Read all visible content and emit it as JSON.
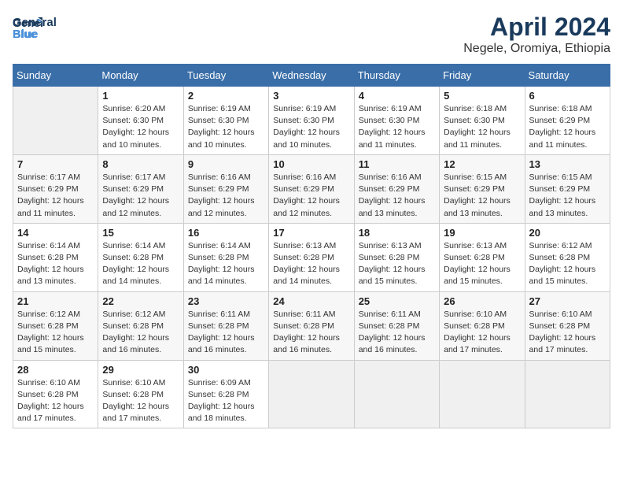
{
  "logo": {
    "line1": "General",
    "line2": "Blue"
  },
  "title": "April 2024",
  "location": "Negele, Oromiya, Ethiopia",
  "days_header": [
    "Sunday",
    "Monday",
    "Tuesday",
    "Wednesday",
    "Thursday",
    "Friday",
    "Saturday"
  ],
  "weeks": [
    [
      {
        "day": "",
        "info": ""
      },
      {
        "day": "1",
        "info": "Sunrise: 6:20 AM\nSunset: 6:30 PM\nDaylight: 12 hours\nand 10 minutes."
      },
      {
        "day": "2",
        "info": "Sunrise: 6:19 AM\nSunset: 6:30 PM\nDaylight: 12 hours\nand 10 minutes."
      },
      {
        "day": "3",
        "info": "Sunrise: 6:19 AM\nSunset: 6:30 PM\nDaylight: 12 hours\nand 10 minutes."
      },
      {
        "day": "4",
        "info": "Sunrise: 6:19 AM\nSunset: 6:30 PM\nDaylight: 12 hours\nand 11 minutes."
      },
      {
        "day": "5",
        "info": "Sunrise: 6:18 AM\nSunset: 6:30 PM\nDaylight: 12 hours\nand 11 minutes."
      },
      {
        "day": "6",
        "info": "Sunrise: 6:18 AM\nSunset: 6:29 PM\nDaylight: 12 hours\nand 11 minutes."
      }
    ],
    [
      {
        "day": "7",
        "info": "Sunrise: 6:17 AM\nSunset: 6:29 PM\nDaylight: 12 hours\nand 11 minutes."
      },
      {
        "day": "8",
        "info": "Sunrise: 6:17 AM\nSunset: 6:29 PM\nDaylight: 12 hours\nand 12 minutes."
      },
      {
        "day": "9",
        "info": "Sunrise: 6:16 AM\nSunset: 6:29 PM\nDaylight: 12 hours\nand 12 minutes."
      },
      {
        "day": "10",
        "info": "Sunrise: 6:16 AM\nSunset: 6:29 PM\nDaylight: 12 hours\nand 12 minutes."
      },
      {
        "day": "11",
        "info": "Sunrise: 6:16 AM\nSunset: 6:29 PM\nDaylight: 12 hours\nand 13 minutes."
      },
      {
        "day": "12",
        "info": "Sunrise: 6:15 AM\nSunset: 6:29 PM\nDaylight: 12 hours\nand 13 minutes."
      },
      {
        "day": "13",
        "info": "Sunrise: 6:15 AM\nSunset: 6:29 PM\nDaylight: 12 hours\nand 13 minutes."
      }
    ],
    [
      {
        "day": "14",
        "info": "Sunrise: 6:14 AM\nSunset: 6:28 PM\nDaylight: 12 hours\nand 13 minutes."
      },
      {
        "day": "15",
        "info": "Sunrise: 6:14 AM\nSunset: 6:28 PM\nDaylight: 12 hours\nand 14 minutes."
      },
      {
        "day": "16",
        "info": "Sunrise: 6:14 AM\nSunset: 6:28 PM\nDaylight: 12 hours\nand 14 minutes."
      },
      {
        "day": "17",
        "info": "Sunrise: 6:13 AM\nSunset: 6:28 PM\nDaylight: 12 hours\nand 14 minutes."
      },
      {
        "day": "18",
        "info": "Sunrise: 6:13 AM\nSunset: 6:28 PM\nDaylight: 12 hours\nand 15 minutes."
      },
      {
        "day": "19",
        "info": "Sunrise: 6:13 AM\nSunset: 6:28 PM\nDaylight: 12 hours\nand 15 minutes."
      },
      {
        "day": "20",
        "info": "Sunrise: 6:12 AM\nSunset: 6:28 PM\nDaylight: 12 hours\nand 15 minutes."
      }
    ],
    [
      {
        "day": "21",
        "info": "Sunrise: 6:12 AM\nSunset: 6:28 PM\nDaylight: 12 hours\nand 15 minutes."
      },
      {
        "day": "22",
        "info": "Sunrise: 6:12 AM\nSunset: 6:28 PM\nDaylight: 12 hours\nand 16 minutes."
      },
      {
        "day": "23",
        "info": "Sunrise: 6:11 AM\nSunset: 6:28 PM\nDaylight: 12 hours\nand 16 minutes."
      },
      {
        "day": "24",
        "info": "Sunrise: 6:11 AM\nSunset: 6:28 PM\nDaylight: 12 hours\nand 16 minutes."
      },
      {
        "day": "25",
        "info": "Sunrise: 6:11 AM\nSunset: 6:28 PM\nDaylight: 12 hours\nand 16 minutes."
      },
      {
        "day": "26",
        "info": "Sunrise: 6:10 AM\nSunset: 6:28 PM\nDaylight: 12 hours\nand 17 minutes."
      },
      {
        "day": "27",
        "info": "Sunrise: 6:10 AM\nSunset: 6:28 PM\nDaylight: 12 hours\nand 17 minutes."
      }
    ],
    [
      {
        "day": "28",
        "info": "Sunrise: 6:10 AM\nSunset: 6:28 PM\nDaylight: 12 hours\nand 17 minutes."
      },
      {
        "day": "29",
        "info": "Sunrise: 6:10 AM\nSunset: 6:28 PM\nDaylight: 12 hours\nand 17 minutes."
      },
      {
        "day": "30",
        "info": "Sunrise: 6:09 AM\nSunset: 6:28 PM\nDaylight: 12 hours\nand 18 minutes."
      },
      {
        "day": "",
        "info": ""
      },
      {
        "day": "",
        "info": ""
      },
      {
        "day": "",
        "info": ""
      },
      {
        "day": "",
        "info": ""
      }
    ]
  ]
}
